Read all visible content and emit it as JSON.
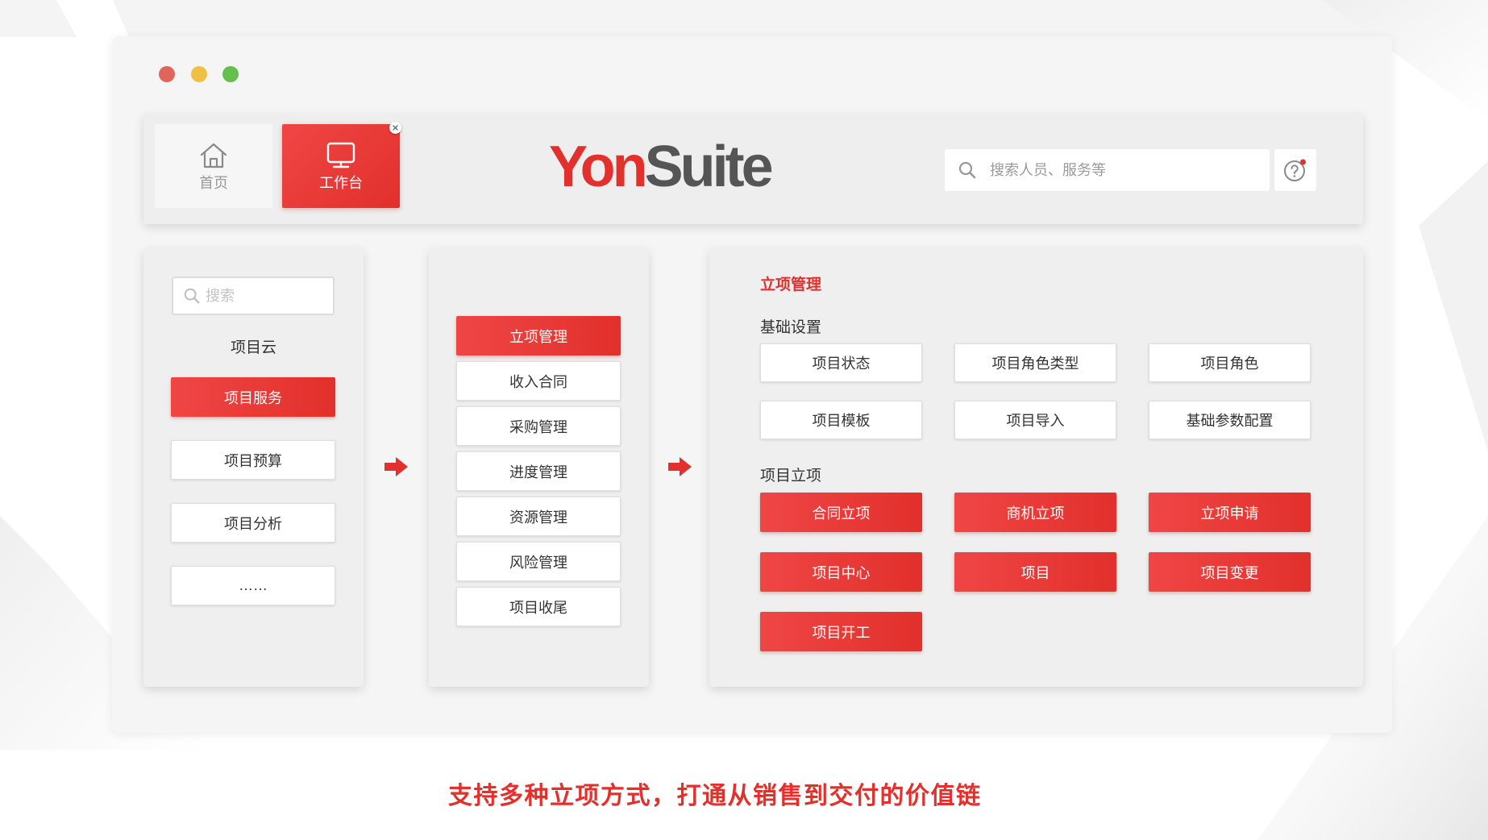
{
  "window_controls": {
    "close": "#e0665c",
    "minimize": "#efc043",
    "maximize": "#63c04d"
  },
  "header": {
    "tabs": [
      {
        "label": "首页",
        "icon": "home-icon",
        "active": false
      },
      {
        "label": "工作台",
        "icon": "monitor-icon",
        "active": true,
        "closable": true
      }
    ],
    "logo": {
      "primary": "Yon",
      "secondary": "Suite"
    },
    "search": {
      "placeholder": "搜索人员、服务等",
      "icon": "search-icon"
    },
    "help": {
      "icon": "help-icon",
      "has_notification": true
    }
  },
  "sidebar": {
    "search": {
      "placeholder": "搜索",
      "icon": "search-icon"
    },
    "title": "项目云",
    "items": [
      {
        "label": "项目服务",
        "active": true
      },
      {
        "label": "项目预算",
        "active": false
      },
      {
        "label": "项目分析",
        "active": false
      },
      {
        "label": "……",
        "active": false
      }
    ]
  },
  "menu": {
    "items": [
      {
        "label": "立项管理",
        "active": true
      },
      {
        "label": "收入合同",
        "active": false
      },
      {
        "label": "采购管理",
        "active": false
      },
      {
        "label": "进度管理",
        "active": false
      },
      {
        "label": "资源管理",
        "active": false
      },
      {
        "label": "风险管理",
        "active": false
      },
      {
        "label": "项目收尾",
        "active": false
      }
    ]
  },
  "detail": {
    "title": "立项管理",
    "sections": [
      {
        "title": "基础设置",
        "items": [
          "项目状态",
          "项目角色类型",
          "项目角色",
          "项目模板",
          "项目导入",
          "基础参数配置"
        ]
      },
      {
        "title": "项目立项",
        "items": [
          "合同立项",
          "商机立项",
          "立项申请",
          "项目中心",
          "项目",
          "项目变更",
          "项目开工"
        ]
      }
    ]
  },
  "flow": {
    "arrow_icon": "arrow-right-icon"
  },
  "caption": "支持多种立项方式，打通从销售到交付的价值链",
  "colors": {
    "accent": "#e2302c",
    "accent_light": "#ef4645",
    "panel": "#efefef",
    "text": "#333333",
    "logo_gray": "#555555",
    "muted": "#999999"
  }
}
